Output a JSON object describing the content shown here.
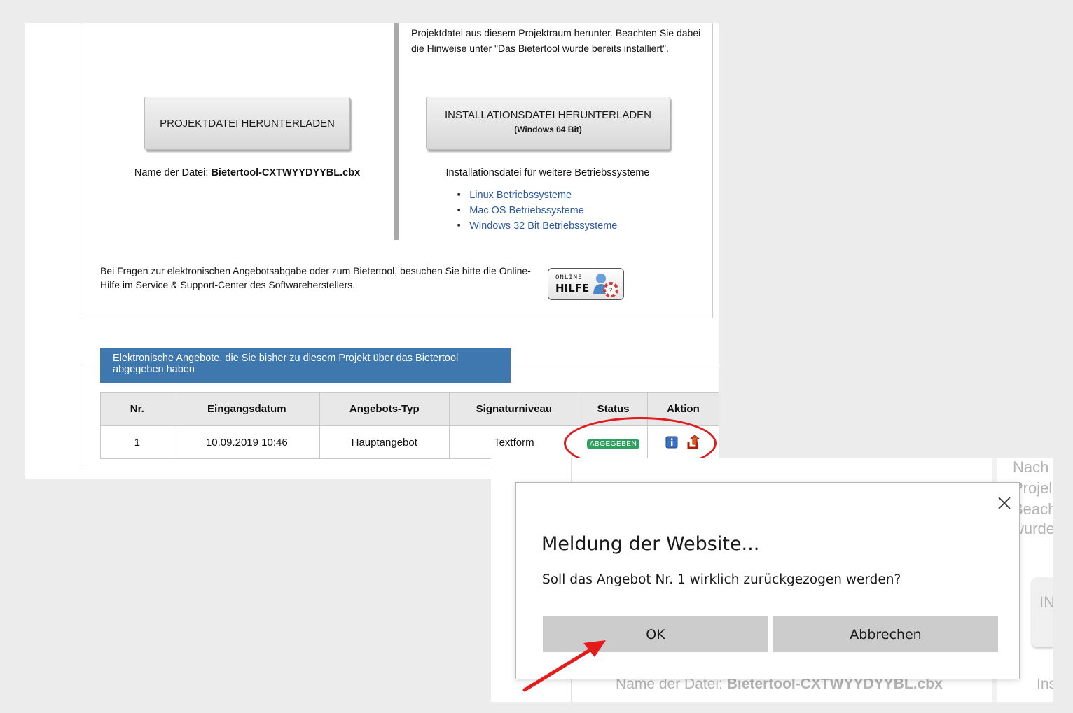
{
  "top_section": {
    "intro_text": "Projektdatei aus diesem Projektraum herunter. Beachten Sie dabei die Hinweise unter \"Das Bietertool wurde bereits installiert\".",
    "download_project_button": "PROJEKTDATEI HERUNTERLADEN",
    "download_install_button": "INSTALLATIONSDATEI HERUNTERLADEN",
    "download_install_sub": "(Windows 64 Bit)",
    "filename_label": "Name der Datei:",
    "filename_value": "Bietertool-CXTWYYDYYBL.cbx",
    "os_heading": "Installationsdatei für weitere Betriebssysteme",
    "os_links": [
      "Linux Betriebssysteme",
      "Mac OS Betriebssysteme",
      "Windows 32 Bit Betriebssysteme"
    ],
    "help_text": "Bei Fragen zur elektronischen Angebotsabgabe oder zum Bietertool, besuchen Sie bitte die Online-Hilfe im Service & Support-Center des Softwareherstellers.",
    "help_button_line1": "ONLINE",
    "help_button_line2": "HILFE"
  },
  "offers": {
    "header": "Elektronische Angebote, die Sie bisher zu diesem Projekt über das Bietertool abgegeben haben",
    "columns": [
      "Nr.",
      "Eingangsdatum",
      "Angebots-Typ",
      "Signaturniveau",
      "Status",
      "Aktion"
    ],
    "rows": [
      {
        "nr": "1",
        "date": "10.09.2019 10:46",
        "type": "Hauptangebot",
        "signature": "Textform",
        "status": "ABGEGEBEN"
      }
    ]
  },
  "background_fragments": {
    "right_words": [
      "Nach",
      "Projel",
      "Beach",
      "wurde"
    ],
    "in_button": "IN",
    "name_label": "Name der Datei:",
    "name_value": "Bietertool-CXTWYYDYYBL.cbx",
    "ins": "Ins"
  },
  "dialog": {
    "title": "Meldung der Website...",
    "message": "Soll das Angebot Nr. 1 wirklich zurückgezogen werden?",
    "ok_label": "OK",
    "cancel_label": "Abbrechen"
  },
  "colors": {
    "accent_header": "#3f78ae",
    "status_badge": "#2e9f5f",
    "annotation_red": "#e31b1b",
    "link_blue": "#2b5aa0"
  }
}
